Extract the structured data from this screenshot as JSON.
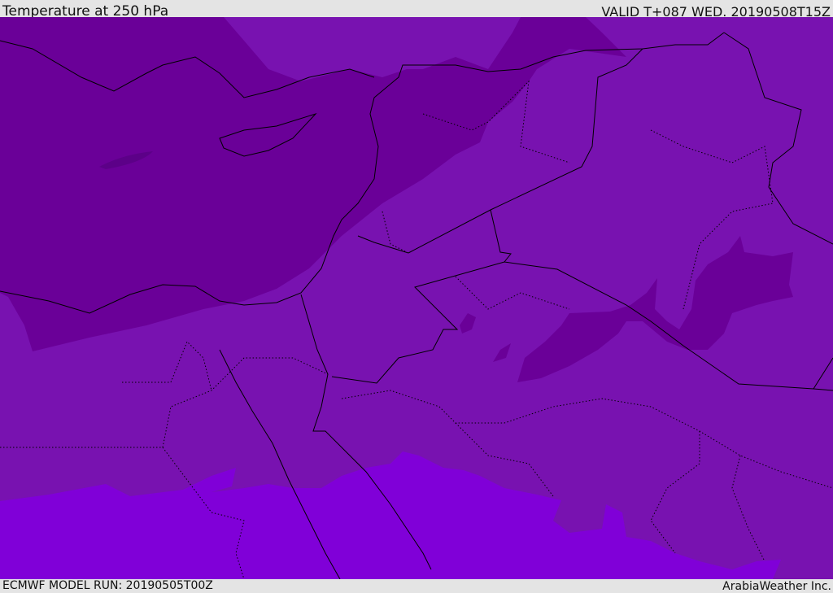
{
  "header": {
    "title": "Temperature at 250 hPa",
    "valid": "VALID T+087 WED. 20190508T15Z"
  },
  "footer": {
    "model_run": "ECMWF MODEL RUN: 20190505T00Z",
    "credit": "ArabiaWeather Inc."
  },
  "colors": {
    "cold": "#6a0098",
    "mid": "#7812b0",
    "warm": "#8000d8",
    "border": "#000000"
  }
}
